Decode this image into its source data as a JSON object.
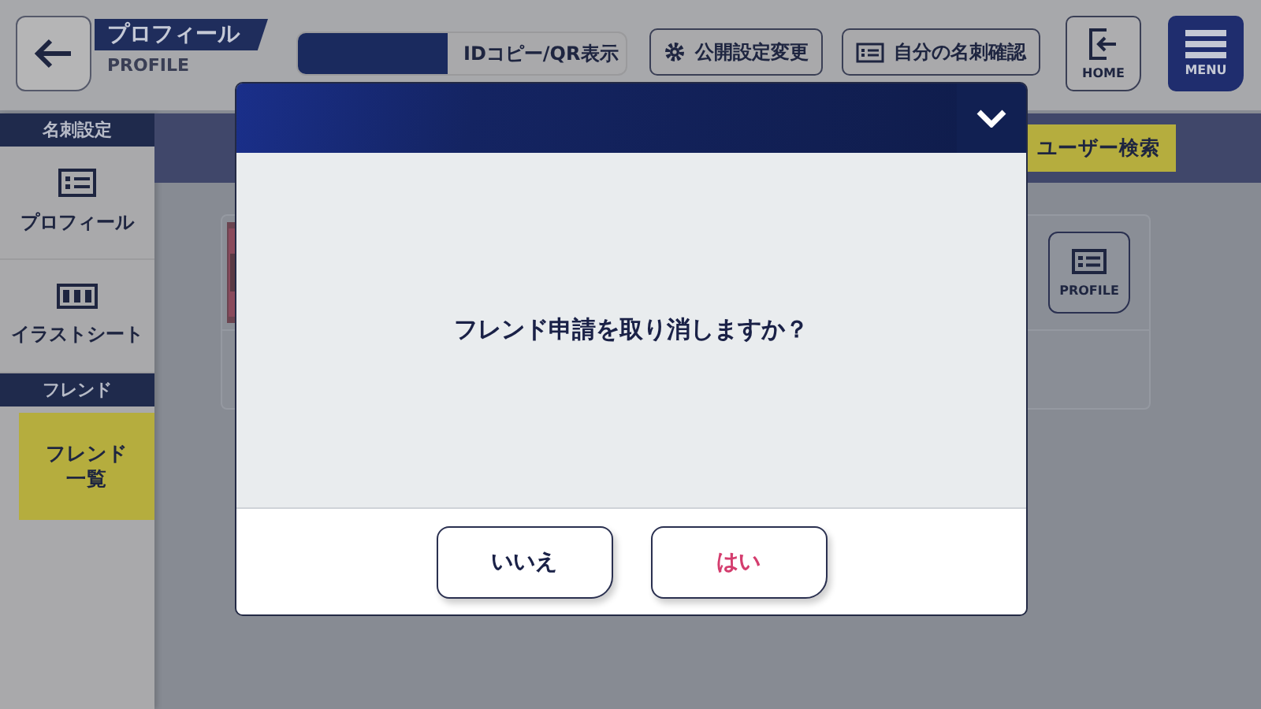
{
  "header": {
    "title": "プロフィール",
    "subtitle": "PROFILE",
    "id_button": "IDコピー/QR表示",
    "buttons": [
      {
        "label": "公開設定変更",
        "kind": "gear"
      },
      {
        "label": "自分の名刺確認",
        "kind": "card"
      }
    ],
    "home": "HOME",
    "menu": "MENU"
  },
  "sidebar": [
    {
      "kind": "section",
      "label": "名刺設定"
    },
    {
      "kind": "card",
      "label": "プロフィール",
      "selected": false
    },
    {
      "kind": "sheet",
      "label": "イラストシート",
      "selected": false
    },
    {
      "kind": "section",
      "label": "フレンド"
    },
    {
      "kind": "item",
      "label": "フレンド一覧",
      "selected": true
    }
  ],
  "main": {
    "search_button": "ユーザー検索",
    "profile_button": "PROFILE"
  },
  "dialog": {
    "message": "フレンド申請を取り消しますか？",
    "buttons": [
      {
        "label": "いいえ",
        "kind": "cancel"
      },
      {
        "label": "はい",
        "kind": "confirm"
      }
    ]
  }
}
